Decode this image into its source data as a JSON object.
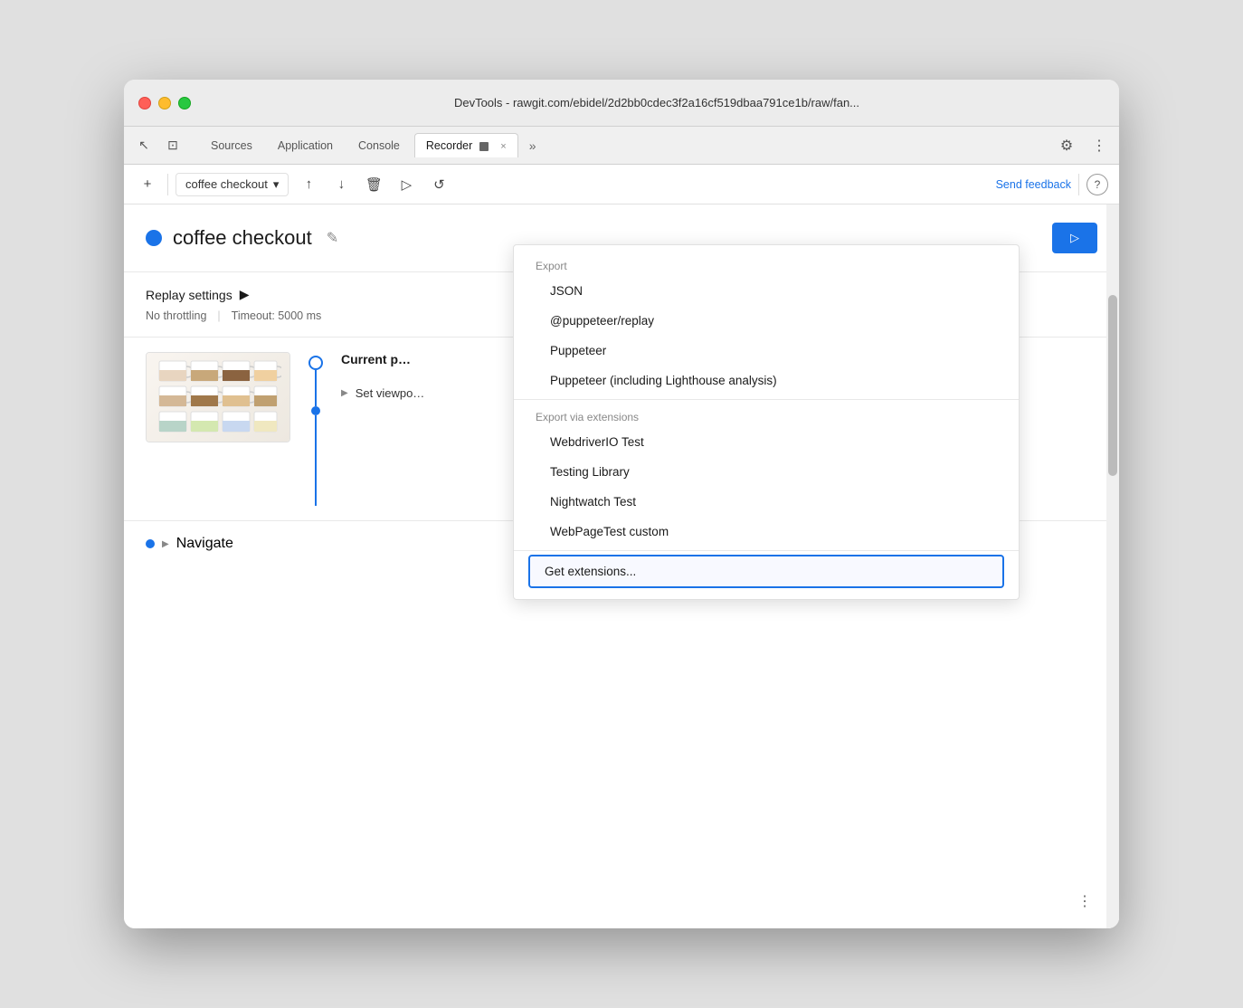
{
  "window": {
    "title": "DevTools - rawgit.com/ebidel/2d2bb0cdec3f2a16cf519dbaa791ce1b/raw/fan..."
  },
  "tabs": {
    "items": [
      {
        "label": "Sources",
        "active": false
      },
      {
        "label": "Application",
        "active": false
      },
      {
        "label": "Console",
        "active": false
      },
      {
        "label": "Recorder",
        "active": true
      }
    ],
    "more_label": "»"
  },
  "toolbar": {
    "add_label": "+",
    "recording_name": "coffee checkout",
    "send_feedback_label": "Send feedback"
  },
  "recording": {
    "title": "coffee checkout",
    "replay_settings_label": "Replay settings",
    "throttling_label": "No throttling",
    "timeout_label": "Timeout: 5000 ms",
    "current_page_label": "Current p…",
    "set_viewport_label": "Set viewpo…",
    "navigate_label": "Navigate"
  },
  "dropdown": {
    "export_label": "Export",
    "items": [
      {
        "label": "JSON",
        "section": "export"
      },
      {
        "label": "@puppeteer/replay",
        "section": "export"
      },
      {
        "label": "Puppeteer",
        "section": "export"
      },
      {
        "label": "Puppeteer (including Lighthouse analysis)",
        "section": "export"
      }
    ],
    "extensions_label": "Export via extensions",
    "extensions_items": [
      {
        "label": "WebdriverIO Test"
      },
      {
        "label": "Testing Library"
      },
      {
        "label": "Nightwatch Test"
      },
      {
        "label": "WebPageTest custom"
      }
    ],
    "get_extensions_label": "Get extensions..."
  },
  "icons": {
    "close": "×",
    "chevron_down": "▾",
    "chevron_right": "▶",
    "edit": "✎",
    "more": "⋮",
    "gear": "⚙",
    "upload": "↑",
    "download": "↓",
    "trash": "🗑",
    "play": "▷",
    "replay": "↺",
    "help": "?",
    "cursor": "↖",
    "panels": "⊞"
  }
}
